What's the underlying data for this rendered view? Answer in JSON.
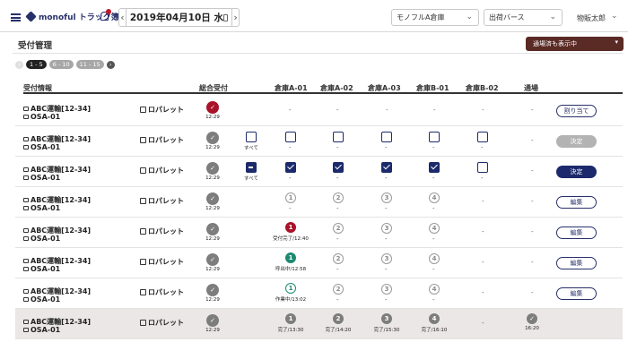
{
  "header": {
    "app_name": "monoful トラック簿",
    "date": "2019年04月10日 水",
    "prev": "‹",
    "next": "›",
    "warehouse": "モノフルA倉庫",
    "berth": "出荷バース",
    "user": "物販太郎"
  },
  "page": {
    "title": "受付管理",
    "filter_label": "通場済も表示中"
  },
  "pagination": [
    "1 - 5",
    "6 - 10",
    "11 - 15"
  ],
  "columns": {
    "info": "受付情報",
    "total": "総合受付",
    "a01": "倉庫A-01",
    "a02": "倉庫A-02",
    "a03": "倉庫A-03",
    "b01": "倉庫B-01",
    "b02": "倉庫B-02",
    "exit": "通場"
  },
  "common": {
    "company": "ABC運輸[12-34]",
    "site": "OSA-01",
    "pallet": "ロパレット",
    "dash": "-",
    "all": "すべて",
    "time": "12:29"
  },
  "rows": [
    {
      "action": "割り当て"
    },
    {
      "action": "決定"
    },
    {
      "action": "決定"
    },
    {
      "action": "編集",
      "s1": "1",
      "s2": "2",
      "s3": "3",
      "s4": "4"
    },
    {
      "action": "編集",
      "s1": "1",
      "s1cap": "受付完了/12:40",
      "s2": "2",
      "s3": "3",
      "s4": "4"
    },
    {
      "action": "編集",
      "s1": "1",
      "s1cap": "呼出中/12:58",
      "s2": "2",
      "s3": "3",
      "s4": "4"
    },
    {
      "action": "編集",
      "s1": "1",
      "s1cap": "作業中/13:02",
      "s2": "2",
      "s3": "3",
      "s4": "4"
    },
    {
      "s1": "1",
      "s1cap": "完了/13:30",
      "s2": "2",
      "s2cap": "完了/14:20",
      "s3": "3",
      "s3cap": "完了/15:30",
      "s4": "4",
      "s4cap": "完了/16:10",
      "exit_time": "16:20"
    }
  ],
  "colors": {
    "navy": "#1c2a6b",
    "red": "#a8132a",
    "teal": "#1c8a73",
    "filter": "#5a2a25"
  }
}
